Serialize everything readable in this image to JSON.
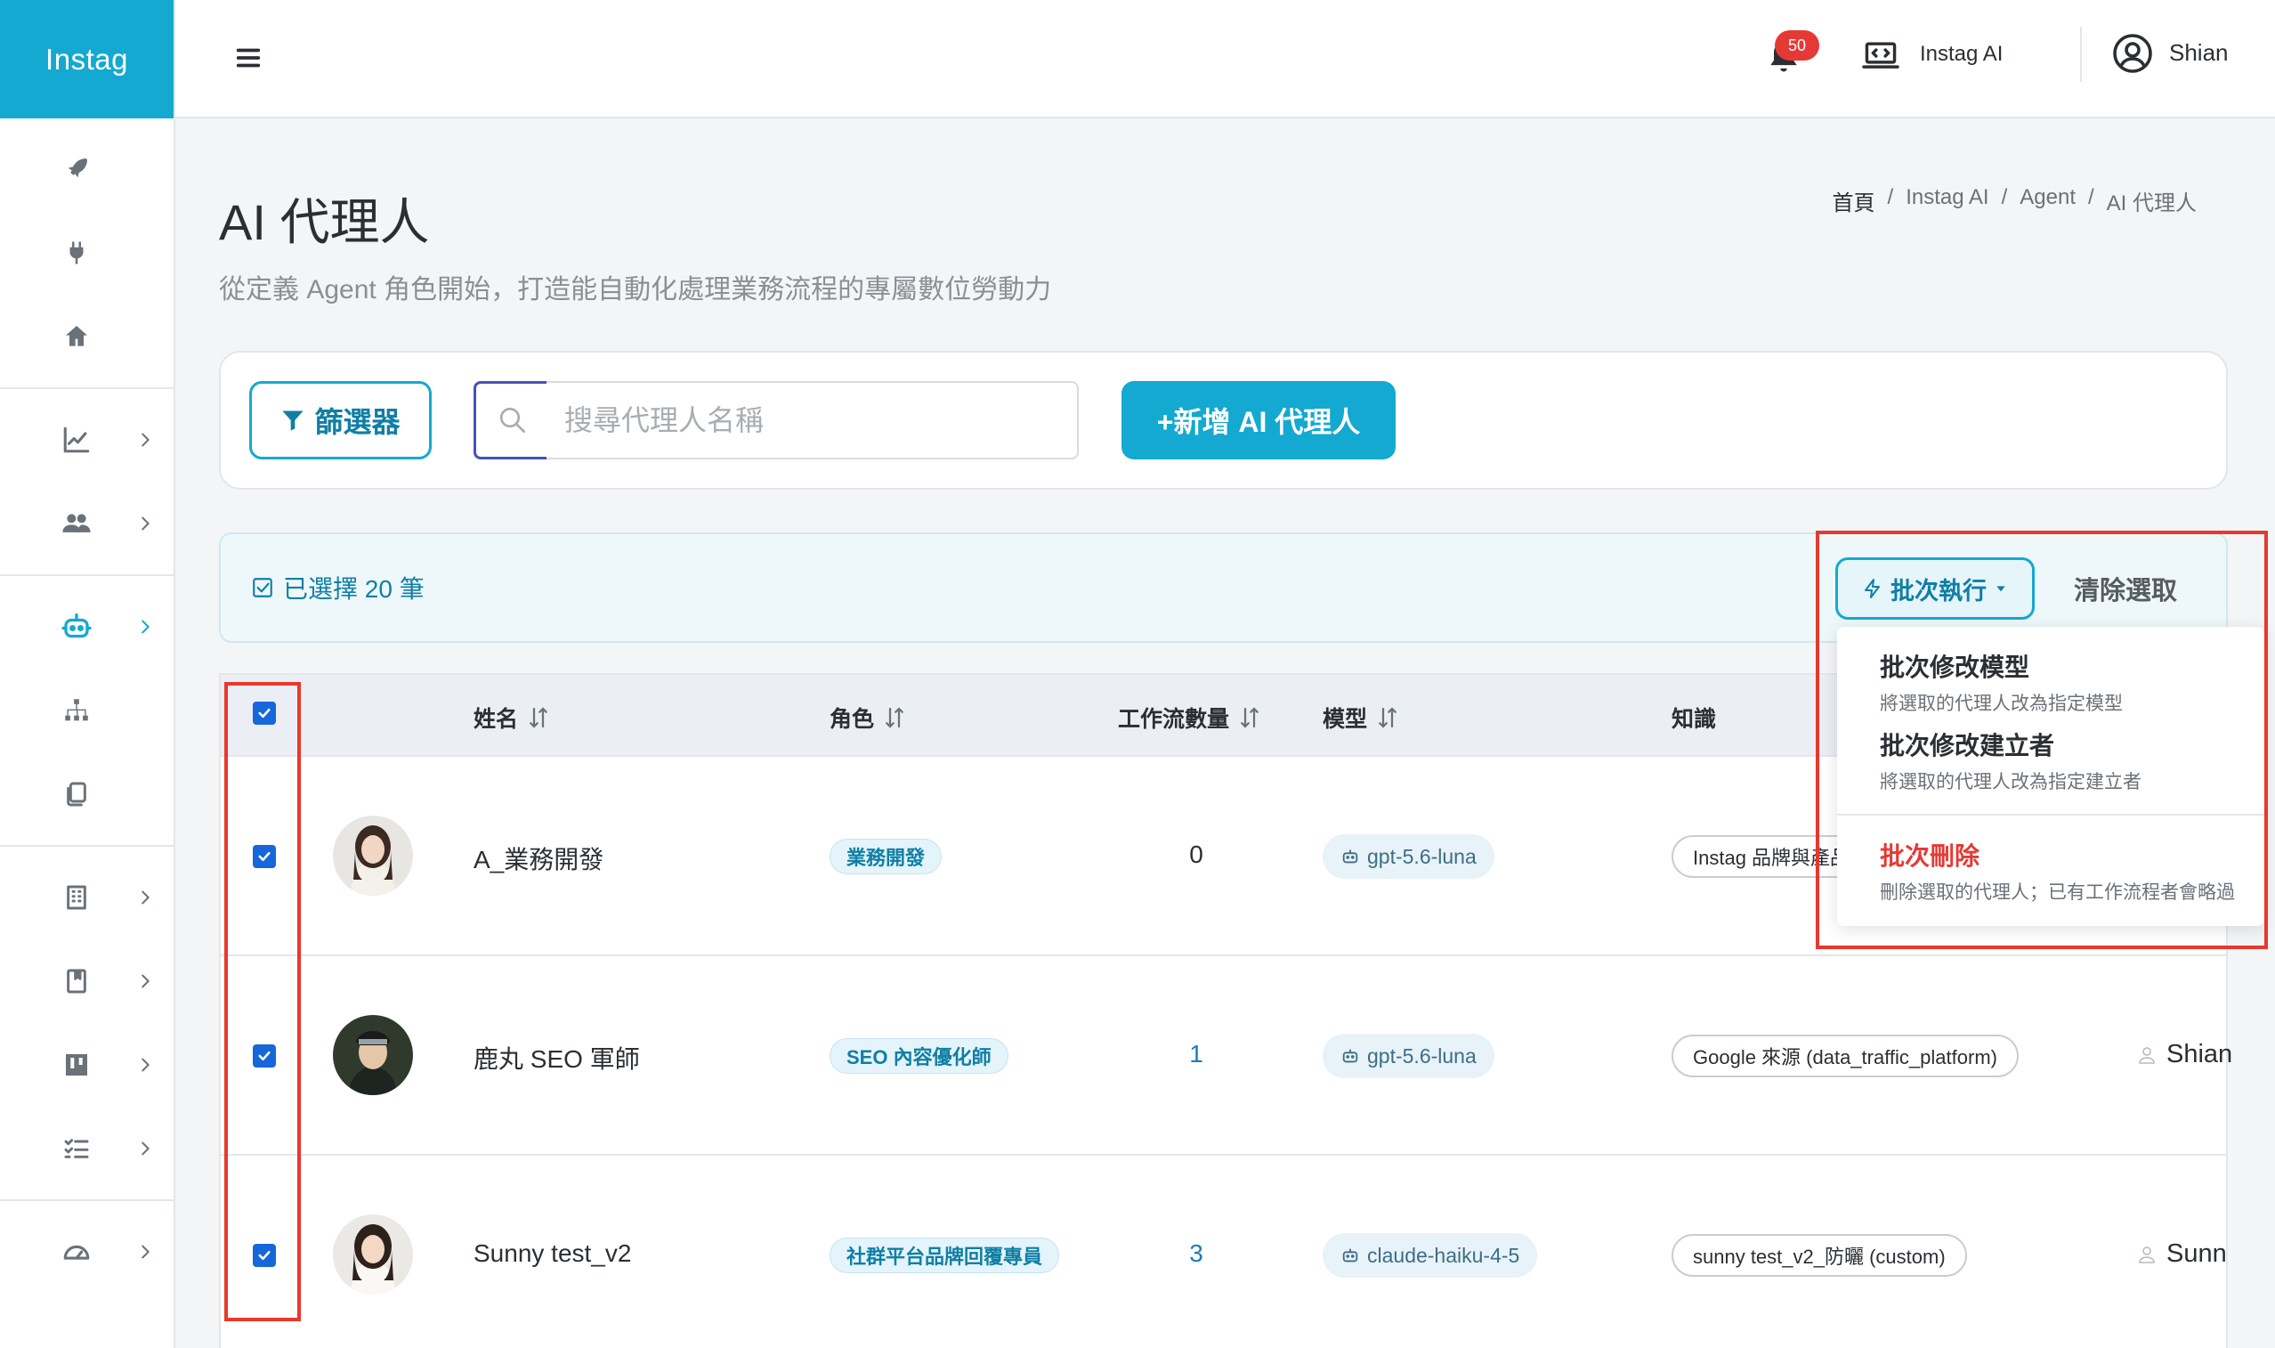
{
  "app": {
    "brand": "Instag"
  },
  "header": {
    "notification_count": "50",
    "ai_label": "Instag AI",
    "user_name": "Shian"
  },
  "page": {
    "title": "AI 代理人",
    "subtitle": "從定義 Agent 角色開始，打造能自動化處理業務流程的專屬數位勞動力",
    "breadcrumb": [
      "首頁",
      "/",
      "Instag AI",
      "/",
      "Agent",
      "/",
      "AI 代理人"
    ]
  },
  "toolbar": {
    "filter_label": "篩選器",
    "search_placeholder": "搜尋代理人名稱",
    "add_label": "+新增 AI 代理人"
  },
  "selection": {
    "label": "已選擇 20 筆",
    "batch_label": "批次執行",
    "clear_label": "清除選取"
  },
  "dropdown": {
    "items": [
      {
        "title": "批次修改模型",
        "desc": "將選取的代理人改為指定模型"
      },
      {
        "title": "批次修改建立者",
        "desc": "將選取的代理人改為指定建立者"
      },
      {
        "title": "批次刪除",
        "desc": "刪除選取的代理人；已有工作流程者會略過"
      }
    ]
  },
  "table": {
    "columns": [
      "姓名",
      "角色",
      "工作流數量",
      "模型",
      "知識"
    ],
    "rows": [
      {
        "name": "A_業務開發",
        "role": "業務開發",
        "workflow_count": "0",
        "model": "gpt-5.6-luna",
        "knowledge": "Instag 品牌與產品",
        "creator": "",
        "count_color": "#2b2f33"
      },
      {
        "name": "鹿丸 SEO 軍師",
        "role": "SEO 內容優化師",
        "workflow_count": "1",
        "model": "gpt-5.6-luna",
        "knowledge": "Google 來源 (data_traffic_platform)",
        "creator": "Shian",
        "count_color": "#1a7fb5"
      },
      {
        "name": "Sunny test_v2",
        "role": "社群平台品牌回覆專員",
        "workflow_count": "3",
        "model": "claude-haiku-4-5",
        "knowledge": "sunny test_v2_防曬 (custom)",
        "creator": "Sunn",
        "count_color": "#1a7fb5"
      }
    ]
  },
  "colors": {
    "accent": "#14a9d1",
    "danger": "#e53935",
    "annotation": "#e8382d"
  }
}
